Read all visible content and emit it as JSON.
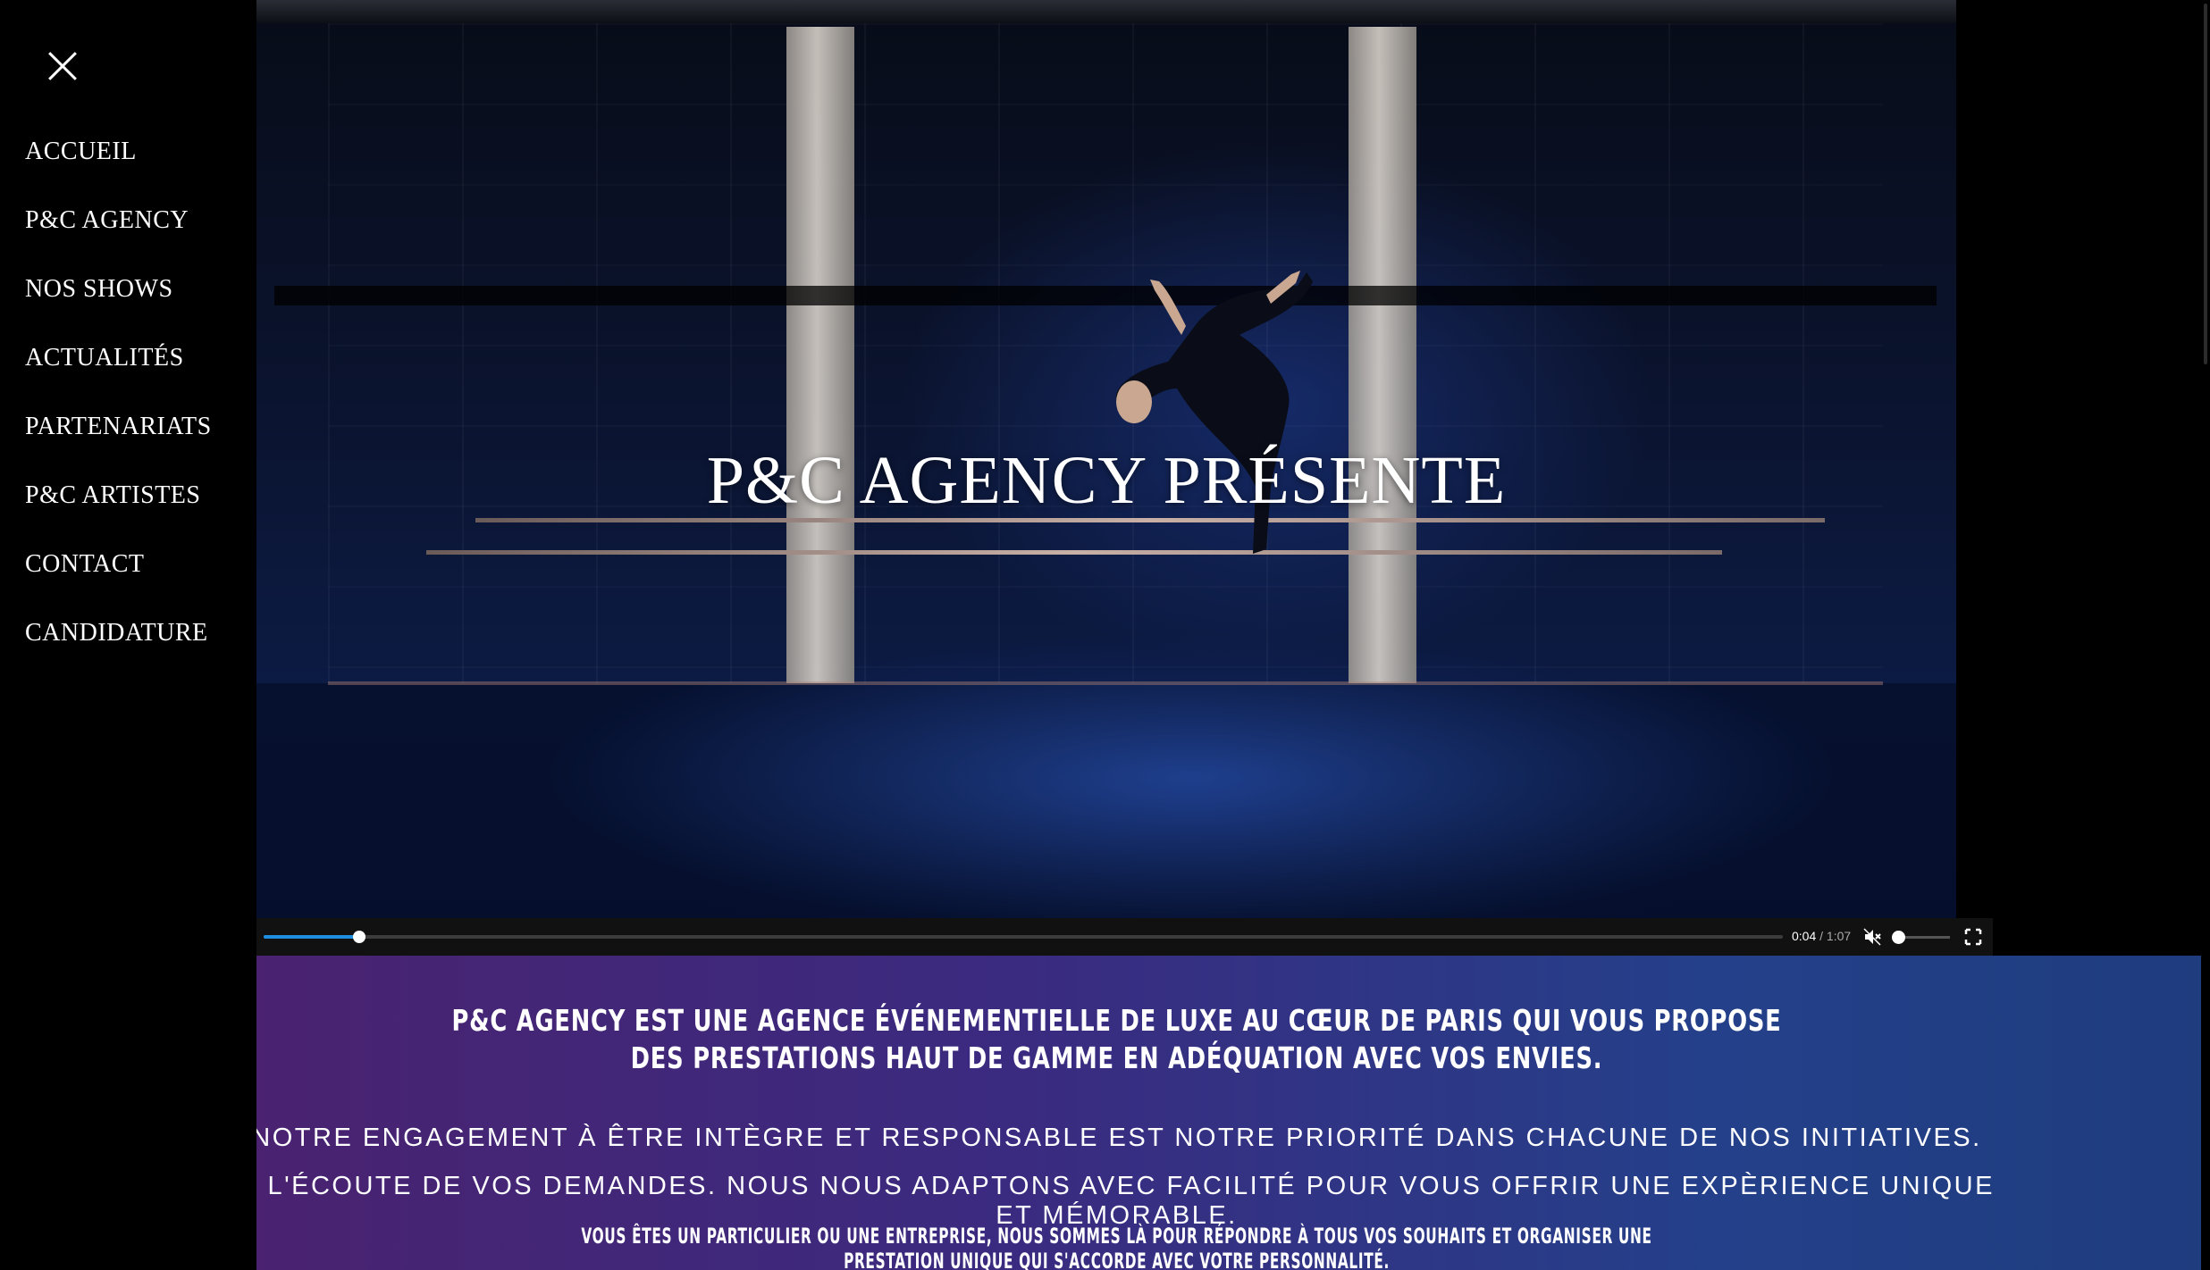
{
  "sidebar": {
    "close_icon": "close-icon",
    "nav_items": [
      {
        "label": "ACCUEIL"
      },
      {
        "label": "P&C AGENCY"
      },
      {
        "label": "NOS SHOWS"
      },
      {
        "label": "ACTUALITÉS"
      },
      {
        "label": "PARTENARIATS"
      },
      {
        "label": "P&C ARTISTES"
      },
      {
        "label": "CONTACT"
      },
      {
        "label": "CANDIDATURE"
      }
    ]
  },
  "video": {
    "title": "P&C AGENCY PRÉSENTE",
    "controls": {
      "current_time": "0:04",
      "separator": "/",
      "duration": "1:07",
      "progress_fraction": 0.063,
      "muted": true,
      "volume_fraction": 0.0,
      "play_icon": "play-icon",
      "mute_icon": "muted-speaker-icon",
      "fullscreen_icon": "fullscreen-icon"
    }
  },
  "intro": {
    "headline": "P&C AGENCY EST UNE AGENCE ÉVÉNEMENTIELLE DE LUXE AU CŒUR DE PARIS QUI VOUS PROPOSE DES PRESTATIONS HAUT DE GAMME EN ADÉQUATION AVEC VOS ENVIES.",
    "line1": "NOTRE ENGAGEMENT À ÊTRE INTÈGRE ET RESPONSABLE EST NOTRE PRIORITÉ DANS CHACUNE DE NOS INITIATIVES.",
    "line2": "Á L'ÉCOUTE DE VOS DEMANDES. NOUS NOUS ADAPTONS AVEC FACILITÉ POUR VOUS OFFRIR UNE EXPÈRIENCE UNIQUE ET MÉMORABLE.",
    "line3": "VOUS ÊTES UN PARTICULIER OU UNE ENTREPRISE, NOUS SOMMES LÀ POUR RÉPONDRE À TOUS VOS SOUHAITS ET ORGANISER UNE PRESTATION UNIQUE QUI S'ACCORDE AVEC VOTRE PERSONNALITÉ."
  },
  "colors": {
    "band_left": "#4a2270",
    "band_right": "#1e3c7e",
    "progress": "#1e8fe0",
    "background": "#000000"
  }
}
